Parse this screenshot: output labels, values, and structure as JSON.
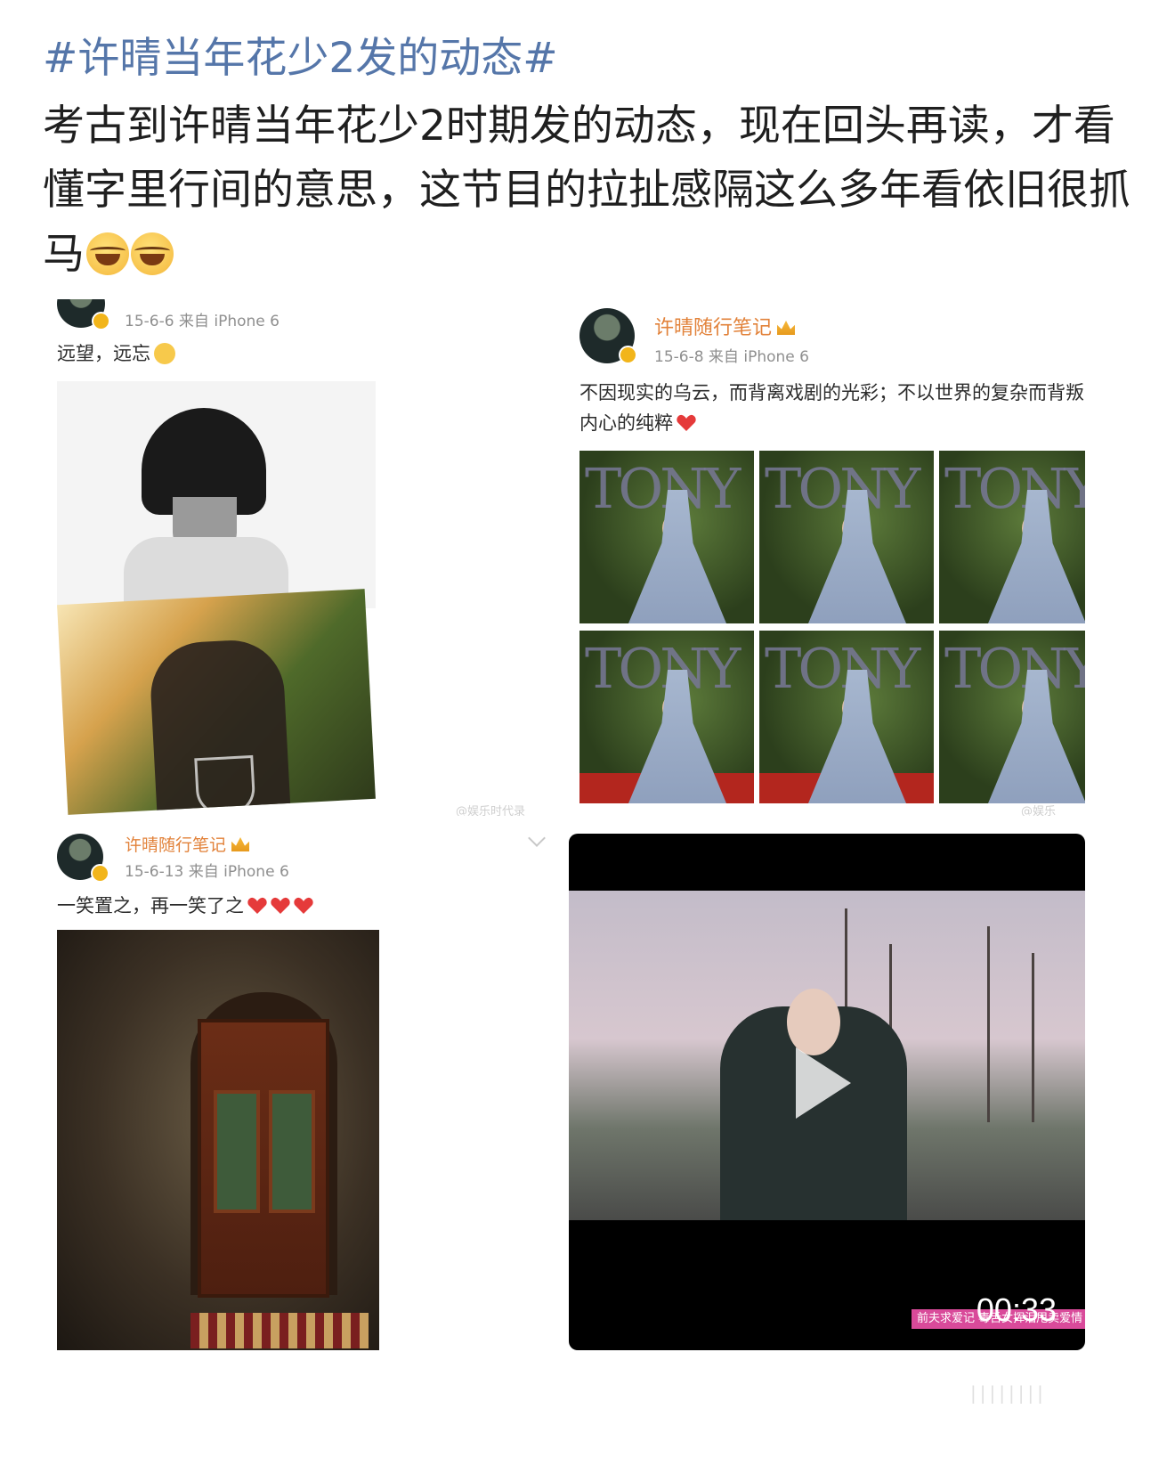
{
  "post": {
    "hashtag": "#许晴当年花少2发的动态#",
    "text": "考古到许晴当年花少2时期发的动态，现在回头再读，才看懂字里行间的意思，这节目的拉扯感隔这么多年看依旧很抓马",
    "emoji": [
      "grinning-tears-icon",
      "grinning-tears-icon"
    ]
  },
  "screenshots": [
    {
      "meta": "15-6-6  来自 iPhone 6",
      "text": "远望，远忘",
      "watermark": "@娱乐时代录"
    },
    {
      "user": "许晴随行笔记",
      "meta": "15-6-8  来自 iPhone 6",
      "text": "不因现实的乌云，而背离戏剧的光彩；不以世界的复杂而背叛内心的纯粹",
      "photo_text": "TONY",
      "watermark": "@娱乐"
    },
    {
      "user": "许晴随行笔记",
      "meta": "15-6-13  来自 iPhone 6",
      "text": "一笑置之，再一笑了之"
    }
  ],
  "video": {
    "duration": "00:33",
    "caption": "前夫求爱记 毒舌女挥泪甩卖爱情"
  },
  "colors": {
    "hashtag": "#5576a9",
    "username": "#e2823a",
    "text": "#1f1f1f"
  }
}
